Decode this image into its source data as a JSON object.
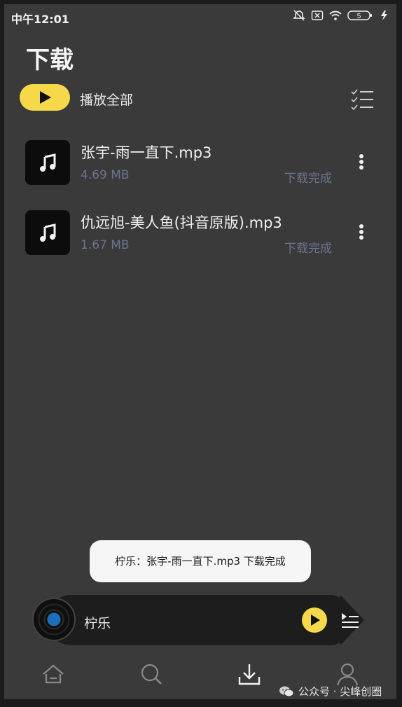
{
  "status_bar": {
    "time": "中午12:01",
    "battery": "5",
    "icons": [
      "alarm-off-icon",
      "sim-icon",
      "wifi-icon",
      "battery-icon",
      "charging-icon"
    ]
  },
  "header": {
    "title": "下载",
    "play_all_label": "播放全部"
  },
  "downloads": [
    {
      "name": "张宇-雨一直下.mp3",
      "size": "4.69 MB",
      "state": "下载完成"
    },
    {
      "name": "仇远旭-美人鱼(抖音原版).mp3",
      "size": "1.67 MB",
      "state": "下载完成"
    }
  ],
  "toast": {
    "text": "柠乐：张宇-雨一直下.mp3 下载完成"
  },
  "mini_player": {
    "title": "柠乐"
  },
  "nav": {
    "tabs": [
      "home-icon",
      "search-icon",
      "download-icon",
      "profile-icon"
    ],
    "active": "download-icon"
  },
  "watermark": {
    "text": "公众号 · 尖峰创圈"
  },
  "colors": {
    "accent": "#f5d94a",
    "background": "#3a3a3a",
    "muted_text": "#6c7390",
    "player_bg": "#1d1d1d"
  }
}
